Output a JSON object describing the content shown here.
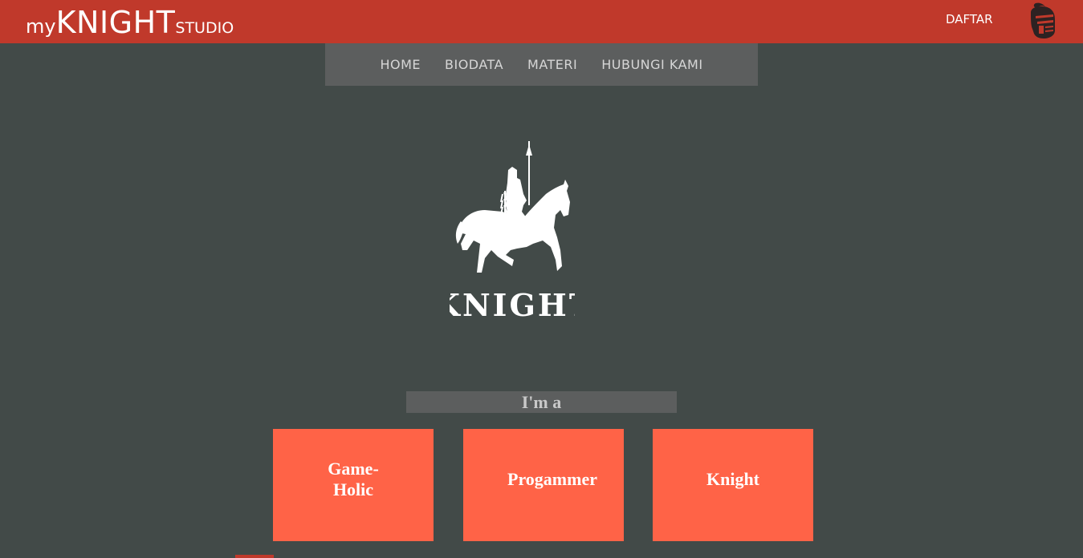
{
  "header": {
    "brand": {
      "prefix": "my",
      "main": "KNIGHT",
      "suffix": "STUDIO"
    },
    "register_label": "DAFTAR",
    "avatar_icon": "knight-helmet-icon",
    "bar_color": "#c0392b"
  },
  "nav": {
    "items": [
      {
        "label": "HOME"
      },
      {
        "label": "BIODATA"
      },
      {
        "label": "MATERI"
      },
      {
        "label": "HUBUNGI KAMI"
      }
    ]
  },
  "hero": {
    "logo_icon": "knight-on-horse-logo",
    "logo_text": "KNIGHT"
  },
  "intro": {
    "label": "I'm a"
  },
  "cards": [
    {
      "line1": "Game-",
      "line2": "Holic"
    },
    {
      "line1": "Progammer",
      "line2": ""
    },
    {
      "line1": "Knight",
      "line2": ""
    }
  ],
  "colors": {
    "background": "#424a48",
    "nav_background": "#5c5e5e",
    "card": "#ff6347"
  }
}
